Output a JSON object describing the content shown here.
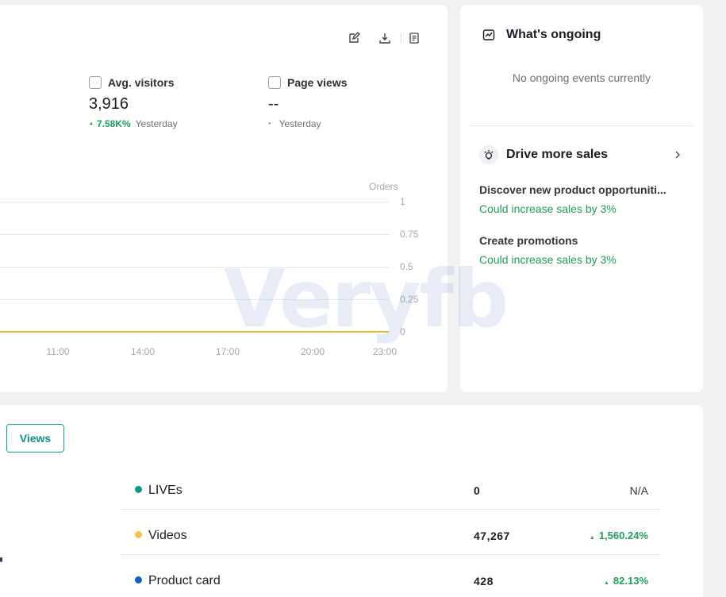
{
  "metrics": {
    "avg_visitors": {
      "label": "Avg. visitors",
      "value": "3,916",
      "change": "7.58K%",
      "comparison": "Yesterday"
    },
    "page_views": {
      "label": "Page views",
      "value": "--",
      "change": "",
      "comparison": "Yesterday"
    }
  },
  "toolbar": {
    "icons": [
      "edit-icon",
      "download-icon",
      "report-icon"
    ]
  },
  "chart_data": {
    "type": "line",
    "ylabel": "Orders",
    "x_ticks": [
      "11:00",
      "14:00",
      "17:00",
      "20:00",
      "23:00"
    ],
    "y_ticks": [
      "1",
      "0.75",
      "0.5",
      "0.25",
      "0"
    ],
    "ylim": [
      0,
      1
    ],
    "series": [
      {
        "color": "#f5b82e",
        "values": [
          0,
          0,
          0,
          0,
          0
        ]
      }
    ]
  },
  "ongoing": {
    "title": "What's ongoing",
    "empty_text": "No ongoing events currently"
  },
  "drive_sales": {
    "title": "Drive more sales",
    "items": [
      {
        "title": "Discover new product opportuniti...",
        "subtitle": "Could increase sales by 3%"
      },
      {
        "title": "Create promotions",
        "subtitle": "Could increase sales by 3%"
      }
    ]
  },
  "traffic": {
    "tab_label": "Views",
    "rows": [
      {
        "name": "LIVEs",
        "value": "0",
        "change": "N/A",
        "color": "#12968a"
      },
      {
        "name": "Videos",
        "value": "47,267",
        "change": "1,560.24%",
        "color": "#f6c344"
      },
      {
        "name": "Product card",
        "value": "428",
        "change": "82.13%",
        "color": "#1261c4"
      }
    ]
  },
  "watermark": "Veryfb"
}
